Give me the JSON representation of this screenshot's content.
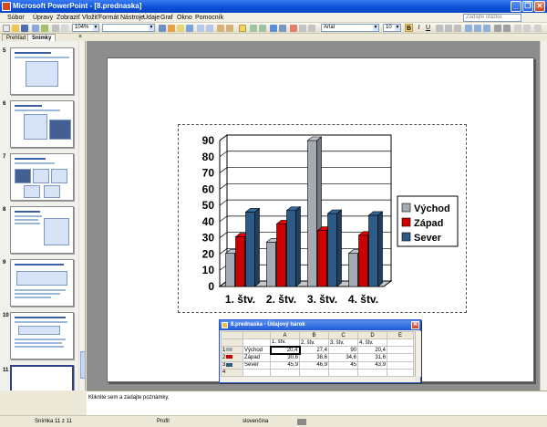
{
  "window": {
    "title": "Microsoft PowerPoint - [8.prednaska]",
    "minimize": "_",
    "restore": "❐",
    "close": "✕"
  },
  "menu": {
    "items": [
      "Súbor",
      "Úpravy",
      "Zobraziť",
      "Vložiť",
      "Formát",
      "Nástroje",
      "Údaje",
      "Graf",
      "Okno",
      "Pomocník"
    ],
    "help_placeholder": "Zadajte otázku"
  },
  "toolbar": {
    "zoom": "104%",
    "font": "Arial",
    "font_size": "10",
    "bold": "B",
    "italic": "I",
    "underline": "U"
  },
  "left_pane": {
    "tabs": [
      "Prehľad",
      "Snímky"
    ],
    "close": "×",
    "slide_numbers": [
      "5",
      "6",
      "7",
      "8",
      "9",
      "10",
      "11"
    ]
  },
  "chart_data": {
    "type": "bar",
    "categories": [
      "1. štv.",
      "2. štv.",
      "3. štv.",
      "4. štv."
    ],
    "series": [
      {
        "name": "Východ",
        "values": [
          20.4,
          27.4,
          90,
          20.4
        ],
        "color": "#a5abb5"
      },
      {
        "name": "Západ",
        "values": [
          30.6,
          38.6,
          34.6,
          31.6
        ],
        "color": "#cc0000"
      },
      {
        "name": "Sever",
        "values": [
          45.9,
          46.9,
          45,
          43.9
        ],
        "color": "#2e5a86"
      }
    ],
    "yticks": [
      "0",
      "10",
      "20",
      "30",
      "40",
      "50",
      "60",
      "70",
      "80",
      "90"
    ],
    "ylim": [
      0,
      90
    ],
    "grid": true,
    "legend": "right",
    "view": "3d"
  },
  "datasheet": {
    "title": "8.prednaska - Údajový hárok",
    "close": "✕",
    "columns": [
      "A",
      "B",
      "C",
      "D",
      "E"
    ],
    "header_row": [
      "1. štv.",
      "2. štv.",
      "3. štv.",
      "4. štv."
    ],
    "row_numbers": [
      "1",
      "2",
      "3",
      "4"
    ],
    "rows": [
      {
        "label": "Východ",
        "values": [
          "20,4",
          "27,4",
          "90",
          "20,4"
        ]
      },
      {
        "label": "Západ",
        "values": [
          "30,6",
          "38,6",
          "34,6",
          "31,6"
        ]
      },
      {
        "label": "Sever",
        "values": [
          "45,9",
          "46,9",
          "45",
          "43,9"
        ]
      }
    ]
  },
  "notes": {
    "placeholder": "Kliknite sem a zadajte poznámky."
  },
  "status": {
    "slide": "Snímka 11 z 11",
    "design": "Profil",
    "language": "slovenčina"
  }
}
